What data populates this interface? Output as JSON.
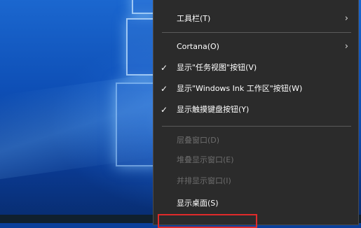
{
  "context_menu": {
    "items": [
      {
        "label": "工具栏(T)",
        "checked": false,
        "enabled": true,
        "submenu": true
      },
      {
        "label": "Cortana(O)",
        "checked": false,
        "enabled": true,
        "submenu": true
      },
      {
        "label": "显示\"任务视图\"按钮(V)",
        "checked": true,
        "enabled": true,
        "submenu": false
      },
      {
        "label": "显示\"Windows Ink 工作区\"按钮(W)",
        "checked": true,
        "enabled": true,
        "submenu": false
      },
      {
        "label": "显示触摸键盘按钮(Y)",
        "checked": true,
        "enabled": true,
        "submenu": false
      },
      {
        "label": "层叠窗口(D)",
        "checked": false,
        "enabled": false,
        "submenu": false
      },
      {
        "label": "堆叠显示窗口(E)",
        "checked": false,
        "enabled": false,
        "submenu": false
      },
      {
        "label": "并排显示窗口(I)",
        "checked": false,
        "enabled": false,
        "submenu": false
      },
      {
        "label": "显示桌面(S)",
        "checked": false,
        "enabled": true,
        "submenu": false
      }
    ],
    "check_glyph": "✓",
    "arrow_glyph": "›"
  },
  "colors": {
    "menu_bg": "#2b2b2b",
    "highlight": "#e02a2a"
  }
}
